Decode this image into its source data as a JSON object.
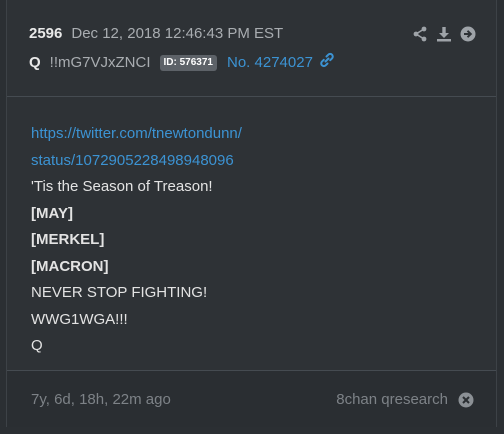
{
  "post": {
    "number": "2596",
    "date": "Dec 12, 2018 12:46:43 PM EST",
    "author": "Q",
    "tripcode": "!!mG7VJxZNCI",
    "id_badge": "ID: 576371",
    "post_link": "No. 4274027",
    "icons": {
      "share": "share-icon",
      "download": "download-icon",
      "goto": "arrow-right-circle-icon",
      "link": "link-icon",
      "close": "close-circle-icon"
    }
  },
  "body": {
    "lines": [
      "https://twitter.com/tnewtondunn/",
      "status/1072905228498948096",
      "'Tis the Season of Treason!",
      "[MAY]",
      "[MERKEL]",
      "[MACRON]",
      "NEVER STOP FIGHTING!",
      "WWG1WGA!!!",
      "Q"
    ]
  },
  "footer": {
    "time_ago": "7y, 6d, 18h, 22m ago",
    "source": "8chan qresearch"
  },
  "colors": {
    "background": "#2e3236",
    "link": "#3c93d3",
    "muted": "#7d8287",
    "badge": "#5d6268"
  }
}
